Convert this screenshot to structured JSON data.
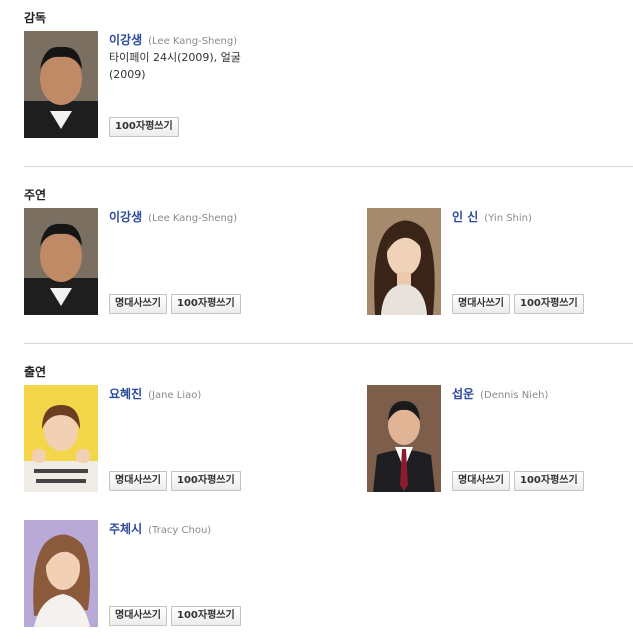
{
  "sections": {
    "director": {
      "title": "감독",
      "people": [
        {
          "name_ko": "이강생",
          "name_en": "(Lee Kang-Sheng)",
          "works": "타이페이 24시(2009), 얼굴(2009)",
          "review_button": "100자평쓰기"
        }
      ]
    },
    "lead": {
      "title": "주연",
      "people": [
        {
          "name_ko": "이강생",
          "name_en": "(Lee Kang-Sheng)",
          "quote_button": "명대사쓰기",
          "review_button": "100자평쓰기"
        },
        {
          "name_ko": "인 신",
          "name_en": "(Yin Shin)",
          "quote_button": "명대사쓰기",
          "review_button": "100자평쓰기"
        }
      ]
    },
    "cast": {
      "title": "출연",
      "people": [
        {
          "name_ko": "요혜진",
          "name_en": "(Jane Liao)",
          "quote_button": "명대사쓰기",
          "review_button": "100자평쓰기"
        },
        {
          "name_ko": "섭운",
          "name_en": "(Dennis Nieh)",
          "quote_button": "명대사쓰기",
          "review_button": "100자평쓰기"
        },
        {
          "name_ko": "주체시",
          "name_en": "(Tracy Chou)",
          "quote_button": "명대사쓰기",
          "review_button": "100자평쓰기"
        }
      ]
    }
  },
  "colors": {
    "name_link": "#2b4a9b",
    "english_name": "#8a8a8a",
    "divider": "#d8d8d8"
  }
}
